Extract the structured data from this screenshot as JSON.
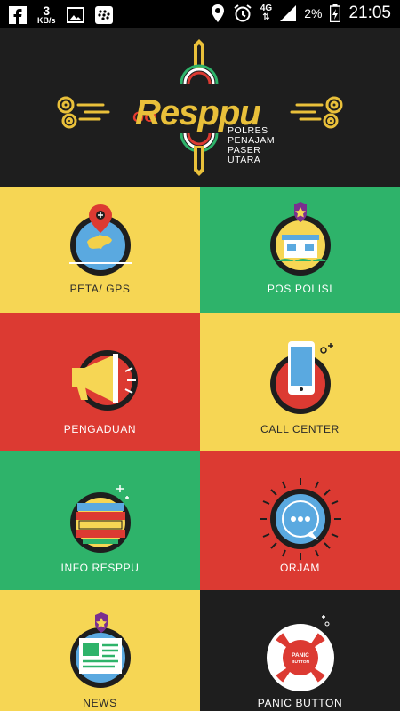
{
  "status_bar": {
    "speed_value": "3",
    "speed_unit": "KB/s",
    "network": "4G",
    "battery": "2%",
    "time": "21:05"
  },
  "header": {
    "logo_go": "GO",
    "logo_name": "Resppu",
    "subtitle_lines": [
      "POLRES",
      "PENAJAM",
      "PASER",
      "UTARA"
    ]
  },
  "menu": {
    "peta_gps": "PETA/ GPS",
    "pos_polisi": "POS POLISI",
    "pengaduan": "PENGADUAN",
    "call_center": "CALL CENTER",
    "info_resppu": "INFO RESPPU",
    "orjam": "ORJAM",
    "news": "NEWS",
    "panic_button": "PANIC BUTTON"
  },
  "icon_text": {
    "panic_line1": "PANIC",
    "panic_line2": "BUTTON"
  },
  "colors": {
    "yellow": "#f6d654",
    "green": "#2eb36a",
    "red": "#dc3a32",
    "dark": "#1e1e1e",
    "gold": "#e9c03a"
  }
}
